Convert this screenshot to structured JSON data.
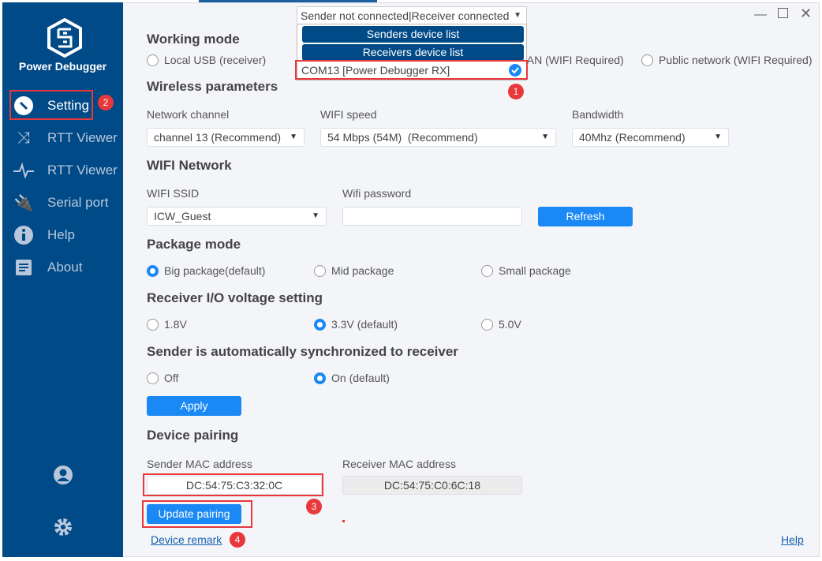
{
  "app": {
    "brand": "Power Debugger"
  },
  "sidebar": {
    "items": [
      {
        "label": "Setting",
        "icon": "wrench-icon",
        "active": true
      },
      {
        "label": "RTT Viewer",
        "icon": "shuffle-icon"
      },
      {
        "label": "RTT Viewer",
        "icon": "pulse-icon"
      },
      {
        "label": "Serial port",
        "icon": "plug-icon"
      },
      {
        "label": "Help",
        "icon": "info-icon"
      },
      {
        "label": "About",
        "icon": "document-icon"
      }
    ],
    "bottom_icons": [
      "user-icon",
      "gear-icon"
    ]
  },
  "connection": {
    "status": "Sender not connected|Receiver connected",
    "senders_button": "Senders device list",
    "receivers_button": "Receivers device list",
    "device": "COM13 [Power Debugger RX]"
  },
  "working_mode": {
    "title": "Working mode",
    "options": [
      "Local USB (receiver)",
      "LAN (WIFI Required)",
      "Public network (WIFI Required)"
    ]
  },
  "wireless": {
    "title": "Wireless parameters",
    "channel_label": "Network channel",
    "channel_value": "channel 13 (Recommend)",
    "speed_label": "WIFI speed",
    "speed_value": "54 Mbps (54M)  (Recommend)",
    "bandwidth_label": "Bandwidth",
    "bandwidth_value": "40Mhz (Recommend)"
  },
  "wifi": {
    "title": "WIFI Network",
    "ssid_label": "WIFI SSID",
    "ssid_value": "ICW_Guest",
    "password_label": "Wifi password",
    "password_value": "",
    "refresh": "Refresh"
  },
  "package": {
    "title": "Package mode",
    "options": [
      "Big package(default)",
      "Mid package",
      "Small package"
    ],
    "selected": 0
  },
  "voltage": {
    "title": "Receiver I/O voltage setting",
    "options": [
      "1.8V",
      "3.3V (default)",
      "5.0V"
    ],
    "selected": 1
  },
  "sync": {
    "title": "Sender is automatically synchronized to receiver",
    "options": [
      "Off",
      "On (default)"
    ],
    "selected": 1,
    "apply": "Apply"
  },
  "pairing": {
    "title": "Device pairing",
    "sender_label": "Sender MAC address",
    "sender_value": "DC:54:75:C3:32:0C",
    "receiver_label": "Receiver MAC address",
    "receiver_value": "DC:54:75:C0:6C:18",
    "update": "Update pairing",
    "remark": "Device remark"
  },
  "footer": {
    "help": "Help"
  },
  "annotations": [
    "1",
    "2",
    "3",
    "4"
  ],
  "colors": {
    "sidebar": "#004a87",
    "accent": "#1a88f5",
    "annotation": "#e8383b"
  }
}
